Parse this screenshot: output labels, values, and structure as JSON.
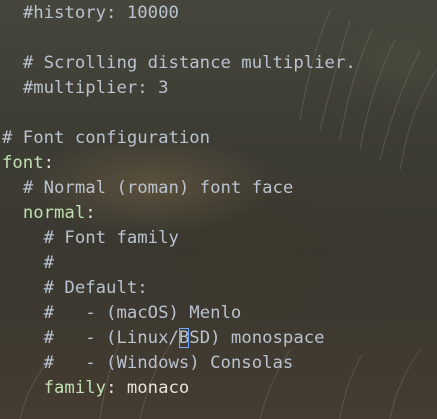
{
  "window": {
    "app": "terminal",
    "file_type": "yaml"
  },
  "editor": {
    "lines": [
      {
        "indent": "  ",
        "text": "#history: 10000",
        "kind": "comment"
      },
      {
        "indent": "",
        "text": "",
        "kind": "blank"
      },
      {
        "indent": "  ",
        "text": "# Scrolling distance multiplier.",
        "kind": "comment"
      },
      {
        "indent": "  ",
        "text": "#multiplier: 3",
        "kind": "comment"
      },
      {
        "indent": "",
        "text": "",
        "kind": "blank"
      },
      {
        "indent": "",
        "text": "# Font configuration",
        "kind": "comment"
      },
      {
        "indent": "",
        "key": "font",
        "sep": ":",
        "kind": "key"
      },
      {
        "indent": "  ",
        "text": "# Normal (roman) font face",
        "kind": "comment"
      },
      {
        "indent": "  ",
        "key": "normal",
        "sep": ":",
        "kind": "key"
      },
      {
        "indent": "    ",
        "text": "# Font family",
        "kind": "comment"
      },
      {
        "indent": "    ",
        "text": "#",
        "kind": "comment"
      },
      {
        "indent": "    ",
        "text": "# Default:",
        "kind": "comment"
      },
      {
        "indent": "    ",
        "text": "#   - (macOS) Menlo",
        "kind": "comment"
      },
      {
        "indent": "    ",
        "pre": "#   - (Linux/",
        "cursor": "B",
        "post": "SD) monospace",
        "kind": "cursor"
      },
      {
        "indent": "    ",
        "text": "#   - (Windows) Consolas",
        "kind": "comment"
      },
      {
        "indent": "    ",
        "key": "family",
        "sep": ": ",
        "value": "monaco",
        "kind": "keyval"
      }
    ]
  },
  "colors": {
    "comment": "#b9c2cf",
    "key": "#bfe0b0",
    "value": "#e6e3d8",
    "cursor": "#6fa8ff"
  }
}
